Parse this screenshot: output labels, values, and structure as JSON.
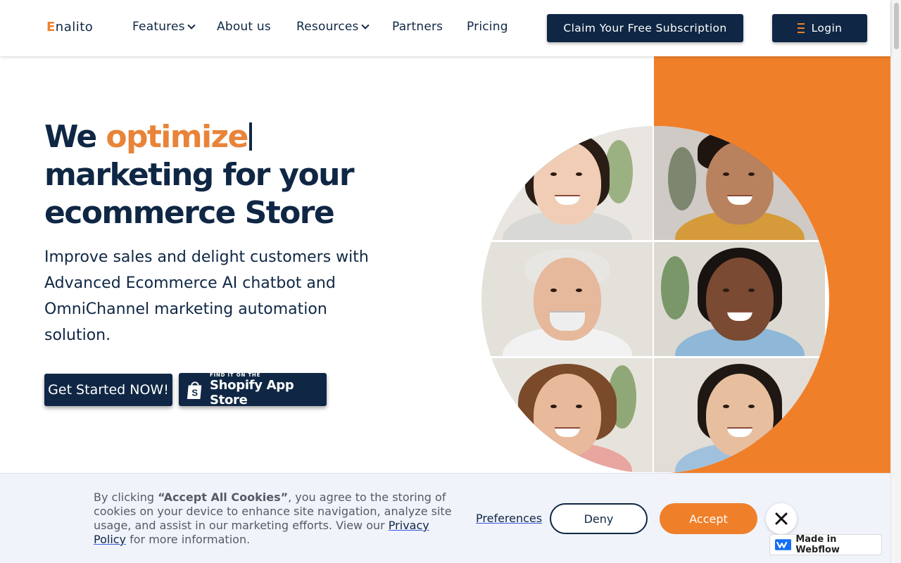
{
  "nav": {
    "logo": "nalito",
    "logo_initial": "E",
    "items": [
      {
        "label": "Features",
        "dropdown": true
      },
      {
        "label": "About us",
        "dropdown": false
      },
      {
        "label": "Resources",
        "dropdown": true
      },
      {
        "label": "Partners",
        "dropdown": false
      },
      {
        "label": "Pricing",
        "dropdown": false
      }
    ],
    "claim_button": "Claim Your Free Subscription",
    "login_button": "Login"
  },
  "hero": {
    "title_we": "We",
    "title_accent": "optimize",
    "title_line2": "marketing for your",
    "title_line3": "ecommerce Store",
    "subtitle": "Improve sales and delight customers with Advanced Ecommerce AI chatbot and OmniChannel marketing automation solution.",
    "cta": "Get Started NOW!",
    "shopify_small": "FIND IT ON THE",
    "shopify_big": "Shopify App Store"
  },
  "cookie": {
    "text_prefix": "By clicking ",
    "text_bold": "“Accept All Cookies”",
    "text_middle": ", you agree to the storing of cookies on your device to enhance site navigation, analyze site usage, and assist in our marketing efforts. View our ",
    "privacy_link": "Privacy Policy",
    "text_suffix": " for more information.",
    "preferences": "Preferences",
    "deny": "Deny",
    "accept": "Accept"
  },
  "badge": {
    "webflow": "Made in Webflow"
  },
  "colors": {
    "navy": "#0f2744",
    "orange": "#f07f2a",
    "banner_bg": "#f0f3fa"
  },
  "icons": [
    "chevron-down-icon",
    "menu-icon",
    "shopify-bag-icon",
    "close-icon",
    "webflow-icon"
  ]
}
